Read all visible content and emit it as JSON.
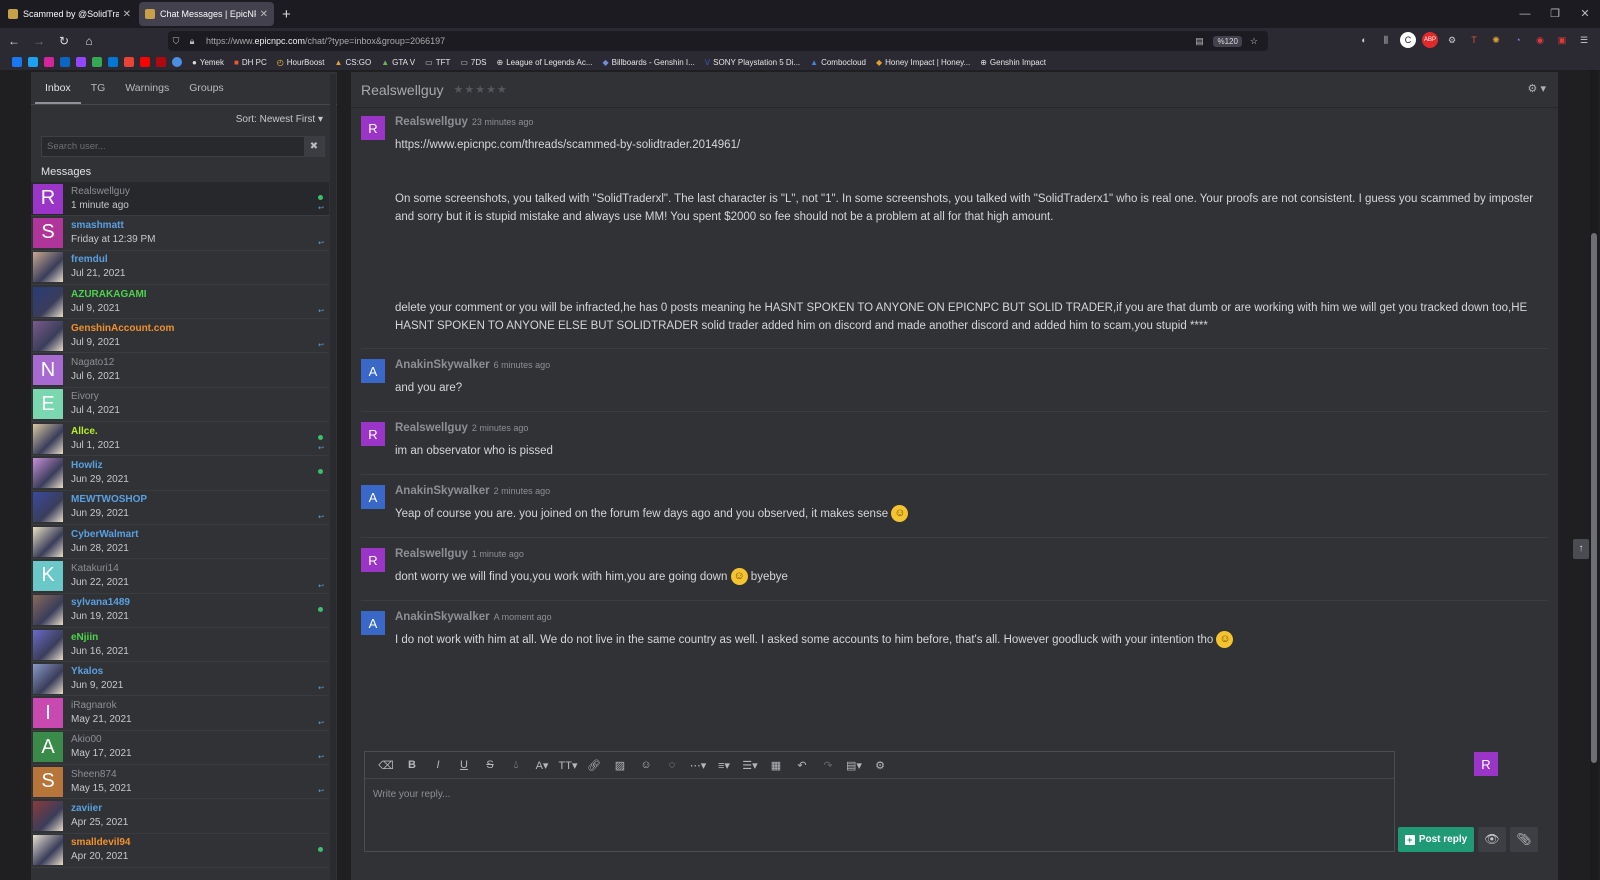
{
  "browser": {
    "tabs": [
      {
        "title": "Scammed by @SolidTrader | Epi"
      },
      {
        "title": "Chat Messages | EpicNPC Mark"
      }
    ],
    "url_prefix": "https://www.",
    "url_domain": "epicnpc.com",
    "url_path": "/chat/?type=inbox&group=2066197",
    "zoom": "%120",
    "bookmarks": [
      {
        "label": "Yemek",
        "color": "#dddddd"
      },
      {
        "label": "DH PC",
        "color": "#e85a2c"
      },
      {
        "label": "HourBoost",
        "color": "#f0c040"
      },
      {
        "label": "CS:GO",
        "color": "#d9a33a"
      },
      {
        "label": "GTA V",
        "color": "#6fb24d"
      },
      {
        "label": "TFT",
        "color": "#cccccc"
      },
      {
        "label": "7DS",
        "color": "#cccccc"
      },
      {
        "label": "League of Legends Ac...",
        "color": "#dddddd"
      },
      {
        "label": "Billboards - Genshin I...",
        "color": "#6f8fd8"
      },
      {
        "label": "SONY Playstation 5 Di...",
        "color": "#3b5bb5"
      },
      {
        "label": "Combocloud",
        "color": "#3a86d8"
      },
      {
        "label": "Honey Impact | Honey...",
        "color": "#e0a030"
      },
      {
        "label": "Genshin Impact",
        "color": "#dddddd"
      }
    ]
  },
  "sidebar": {
    "tabs": [
      "Inbox",
      "TG",
      "Warnings",
      "Groups"
    ],
    "sort_label": "Sort: Newest First",
    "search_placeholder": "Search user...",
    "messages_header": "Messages",
    "conversations": [
      {
        "name": "Realswellguy",
        "date": "1 minute ago",
        "letter": "R",
        "avatar_color": "#9b35c8",
        "name_color": "#8d8f94",
        "online": true,
        "replied": true,
        "active": true
      },
      {
        "name": "smashmatt",
        "date": "Friday at 12:39 PM",
        "letter": "S",
        "avatar_color": "#b0359b",
        "name_color": "#5aa0e0",
        "online": false,
        "replied": true
      },
      {
        "name": "fremdul",
        "date": "Jul 21, 2021",
        "letter": "",
        "avatar_color": "#c8a890",
        "name_color": "#5aa0e0",
        "online": false,
        "replied": false
      },
      {
        "name": "AZURAKAGAMI",
        "date": "Jul 9, 2021",
        "letter": "",
        "avatar_color": "#2a3a7a",
        "name_color": "#4cd44c",
        "online": false,
        "replied": true
      },
      {
        "name": "GenshinAccount.com",
        "date": "Jul 9, 2021",
        "letter": "",
        "avatar_color": "#7a5a8a",
        "name_color": "#f0922a",
        "online": false,
        "replied": true
      },
      {
        "name": "Nagato12",
        "date": "Jul 6, 2021",
        "letter": "N",
        "avatar_color": "#a76ad0",
        "name_color": "#8d8f94",
        "online": false,
        "replied": false
      },
      {
        "name": "Eivory",
        "date": "Jul 4, 2021",
        "letter": "E",
        "avatar_color": "#7ad8b0",
        "name_color": "#8d8f94",
        "online": false,
        "replied": false
      },
      {
        "name": "Allce.",
        "date": "Jul 1, 2021",
        "letter": "",
        "avatar_color": "#d8c8a0",
        "name_color": "#b8f020",
        "online": true,
        "replied": true
      },
      {
        "name": "Howliz",
        "date": "Jun 29, 2021",
        "letter": "",
        "avatar_color": "#c890d8",
        "name_color": "#5aa0e0",
        "online": true,
        "replied": false
      },
      {
        "name": "MEWTWOSHOP",
        "date": "Jun 29, 2021",
        "letter": "",
        "avatar_color": "#3a4aa0",
        "name_color": "#5aa0e0",
        "online": false,
        "replied": true
      },
      {
        "name": "CyberWalmart",
        "date": "Jun 28, 2021",
        "letter": "",
        "avatar_color": "#e8e0c0",
        "name_color": "#5aa0e0",
        "online": false,
        "replied": false
      },
      {
        "name": "Katakuri14",
        "date": "Jun 22, 2021",
        "letter": "K",
        "avatar_color": "#6ac8c8",
        "name_color": "#8d8f94",
        "online": false,
        "replied": true
      },
      {
        "name": "sylvana1489",
        "date": "Jun 19, 2021",
        "letter": "",
        "avatar_color": "#8a6a5a",
        "name_color": "#5aa0e0",
        "online": true,
        "replied": false
      },
      {
        "name": "eNjiin",
        "date": "Jun 16, 2021",
        "letter": "",
        "avatar_color": "#6a6ac8",
        "name_color": "#4cd44c",
        "online": false,
        "replied": false
      },
      {
        "name": "Ykalos",
        "date": "Jun 9, 2021",
        "letter": "",
        "avatar_color": "#8a9ac8",
        "name_color": "#5aa0e0",
        "online": false,
        "replied": true
      },
      {
        "name": "iRagnarok",
        "date": "May 21, 2021",
        "letter": "I",
        "avatar_color": "#c84ab0",
        "name_color": "#8d8f94",
        "online": false,
        "replied": true
      },
      {
        "name": "Akio00",
        "date": "May 17, 2021",
        "letter": "A",
        "avatar_color": "#3a8a4a",
        "name_color": "#8d8f94",
        "online": false,
        "replied": true
      },
      {
        "name": "Sheen874",
        "date": "May 15, 2021",
        "letter": "S",
        "avatar_color": "#b8753a",
        "name_color": "#8d8f94",
        "online": false,
        "replied": true
      },
      {
        "name": "zaviier",
        "date": "Apr 25, 2021",
        "letter": "",
        "avatar_color": "#8a3a3a",
        "name_color": "#5aa0e0",
        "online": false,
        "replied": false
      },
      {
        "name": "smalldevil94",
        "date": "Apr 20, 2021",
        "letter": "",
        "avatar_color": "#e8e0d0",
        "name_color": "#f0922a",
        "online": true,
        "replied": false
      }
    ]
  },
  "chat": {
    "title": "Realswellguy",
    "stars": "★★★★★",
    "messages": [
      {
        "author": "Realswellguy",
        "time": "23 minutes ago",
        "letter": "R",
        "kind": "r",
        "paragraphs": [
          "https://www.epicnpc.com/threads/scammed-by-solidtrader.2014961/",
          "On some screenshots, you talked with \"SolidTraderxl\". The last character is \"L\", not \"1\". In some screenshots, you talked with \"SolidTraderx1\" who is real one. Your proofs are not consistent. I guess you scammed by imposter and sorry but it is stupid mistake and always use MM! You spent $2000 so fee should not be a problem at all for that high amount.",
          "delete your comment or you will be infracted,he has 0 posts meaning he HASNT SPOKEN TO ANYONE ON EPICNPC BUT SOLID TRADER,if you are that dumb or are working with him we will get you tracked down too,HE HASNT SPOKEN TO ANYONE ELSE BUT SOLIDTRADER solid trader added him on discord and made another discord and added him to scam,you stupid ****"
        ]
      },
      {
        "author": "AnakinSkywalker",
        "time": "6 minutes ago",
        "letter": "A",
        "kind": "a",
        "text": "and you are?"
      },
      {
        "author": "Realswellguy",
        "time": "2 minutes ago",
        "letter": "R",
        "kind": "r",
        "text": "im an observator who is pissed"
      },
      {
        "author": "AnakinSkywalker",
        "time": "2 minutes ago",
        "letter": "A",
        "kind": "a",
        "text": "Yeap of course you are. you joined on the forum few days ago and you observed, it makes sense"
      },
      {
        "author": "Realswellguy",
        "time": "1 minute ago",
        "letter": "R",
        "kind": "r",
        "text": "dont worry we will find you,you work with him,you are going down",
        "text_after": "byebye"
      },
      {
        "author": "AnakinSkywalker",
        "time": "A moment ago",
        "letter": "A",
        "kind": "a",
        "text": "I do not work with him at all. We do not live in the same country as well. I asked some accounts to him before, that's all. However goodluck with your intention tho"
      }
    ],
    "reply_placeholder": "Write your reply...",
    "post_reply": "Post reply",
    "my_avatar_letter": "R"
  }
}
